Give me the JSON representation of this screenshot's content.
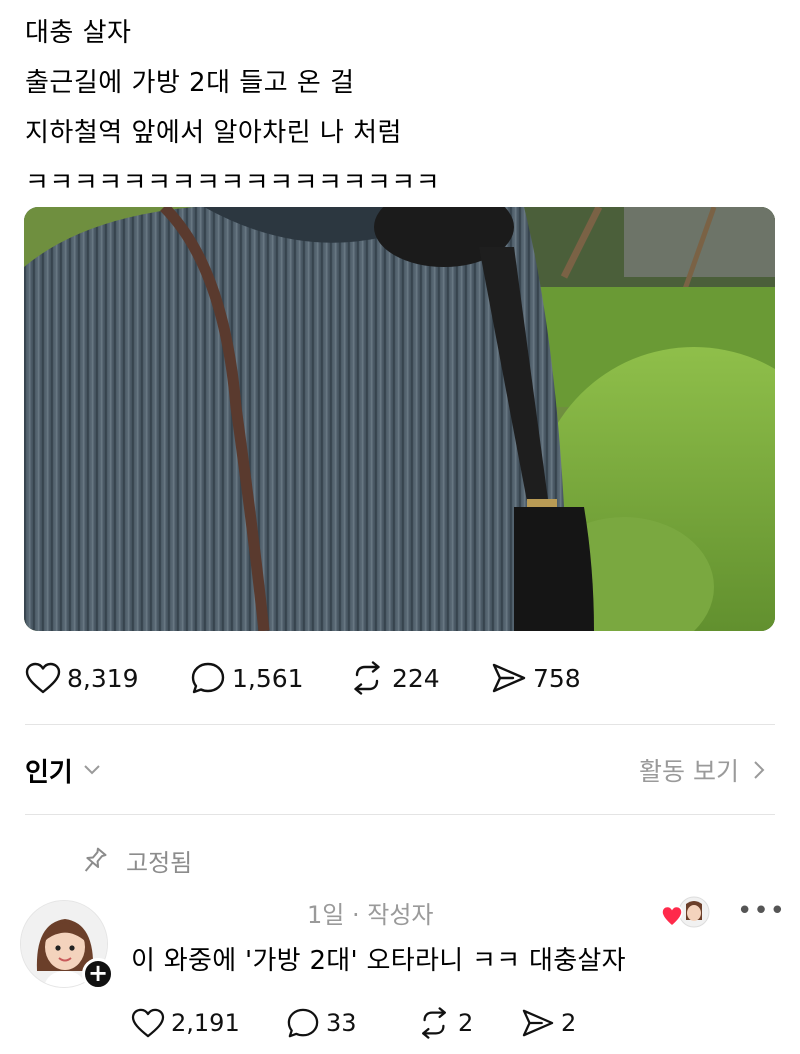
{
  "post": {
    "lines": [
      "대충 살자",
      "출근길에 가방 2대 들고 온 걸",
      "지하철역 앞에서 알아차린 나 처럼",
      "ㅋㅋㅋㅋㅋㅋㅋㅋㅋㅋㅋㅋㅋㅋㅋㅋㅋ"
    ],
    "stats": {
      "likes": "8,319",
      "comments": "1,561",
      "reposts": "224",
      "shares": "758"
    }
  },
  "sort": {
    "label": "인기",
    "activity_label": "활동 보기"
  },
  "pinned": {
    "label": "고정됨"
  },
  "reply": {
    "meta": "1일 · 작성자",
    "text": "이 와중에 '가방 2대' 오타라니 ㅋㅋ 대충살자",
    "stats": {
      "likes": "2,191",
      "comments": "33",
      "reposts": "2",
      "shares": "2"
    }
  },
  "colors": {
    "heart_red": "#ff2a4b",
    "muted_gray": "#9a9a9a"
  },
  "icons": [
    "heart-icon",
    "comment-icon",
    "repost-icon",
    "share-icon",
    "chevron-down-icon",
    "chevron-right-icon",
    "pin-icon",
    "more-icon",
    "plus-icon"
  ]
}
